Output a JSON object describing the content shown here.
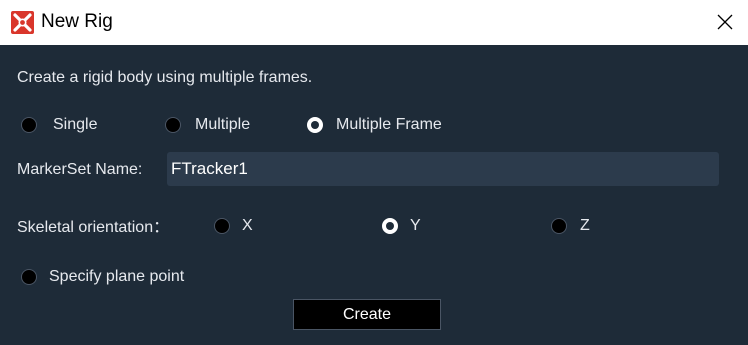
{
  "window": {
    "title": "New Rig",
    "icon": "app-logo-icon",
    "close_icon": "close-icon"
  },
  "description": "Create a rigid body using multiple frames.",
  "rig_type": {
    "options": [
      {
        "label": "Single",
        "checked": false
      },
      {
        "label": "Multiple",
        "checked": false
      },
      {
        "label": "Multiple Frame",
        "checked": true
      }
    ]
  },
  "markerset": {
    "label": "MarkerSet Name:",
    "value": "FTracker1"
  },
  "orientation": {
    "label": "Skeletal orientation：",
    "options": [
      {
        "label": "X",
        "checked": false
      },
      {
        "label": "Y",
        "checked": true
      },
      {
        "label": "Z",
        "checked": false
      }
    ]
  },
  "plane_point": {
    "label": "Specify plane point",
    "checked": false
  },
  "create_button": {
    "label": "Create"
  },
  "colors": {
    "background": "#1e2b38",
    "titlebar": "#ffffff",
    "input_bg": "#2c3b4c",
    "icon_red": "#d9362b"
  }
}
